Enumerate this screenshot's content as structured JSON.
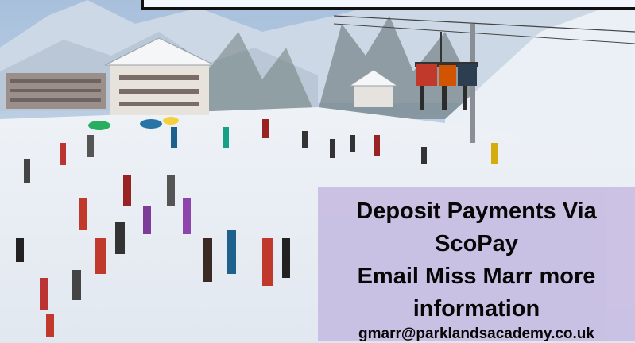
{
  "slide": {
    "info_panel": {
      "line1": "Deposit Payments Via",
      "line2": "ScoPay",
      "line3": "Email Miss Marr more",
      "line4": "information",
      "email": "gmarr@parklandsacademy.co.uk"
    },
    "background_photo": "ski-resort-slope",
    "colors": {
      "panel": "#c9c0e3",
      "sky": "#9fb8d6",
      "snow": "#eef2f6"
    }
  }
}
